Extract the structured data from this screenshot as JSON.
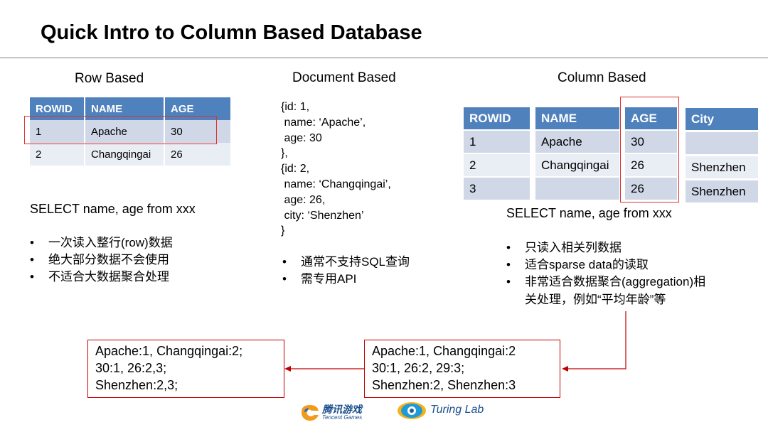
{
  "title": "Quick Intro to Column Based Database",
  "row_based": {
    "heading": "Row Based",
    "headers": [
      "ROWID",
      "NAME",
      "AGE"
    ],
    "rows": [
      [
        "1",
        "Apache",
        "30"
      ],
      [
        "2",
        "Changqingai",
        "26"
      ]
    ],
    "sql": "SELECT name, age from xxx",
    "bullets": [
      "一次读入整行(row)数据",
      "绝大部分数据不会使用",
      "不适合大数据聚合处理"
    ]
  },
  "document_based": {
    "heading": "Document Based",
    "code": "{id: 1,\n name: ‘Apache’,\n age: 30\n},\n{id: 2,\n name: ‘Changqingai’,\n age: 26,\n city: ‘Shenzhen’\n}",
    "bullets": [
      "通常不支持SQL查询",
      "需专用API"
    ]
  },
  "column_based": {
    "heading": "Column Based",
    "rowid": {
      "header": "ROWID",
      "values": [
        "1",
        "2",
        "3"
      ]
    },
    "name": {
      "header": "NAME",
      "values": [
        "Apache",
        "Changqingai",
        ""
      ]
    },
    "age": {
      "header": "AGE",
      "values": [
        "30",
        "26",
        "26"
      ]
    },
    "city": {
      "header": "City",
      "values": [
        "",
        "Shenzhen",
        "Shenzhen"
      ]
    },
    "sql": "SELECT name, age from xxx",
    "bullets": [
      "只读入相关列数据",
      "适合sparse data的读取",
      "非常适合数据聚合(aggregation)相",
      "关处理，例如“平均年龄”等"
    ]
  },
  "boxes": {
    "left": "Apache:1, Changqingai:2;\n30:1, 26:2,3;\nShenzhen:2,3;",
    "right": "Apache:1, Changqingai:2\n30:1, 26:2, 29:3;\nShenzhen:2, Shenzhen:3"
  },
  "logos": {
    "tencent_games_cn": "腾讯游戏",
    "tencent_games_en": "Tencent Games",
    "turing_lab": "Turing Lab"
  }
}
